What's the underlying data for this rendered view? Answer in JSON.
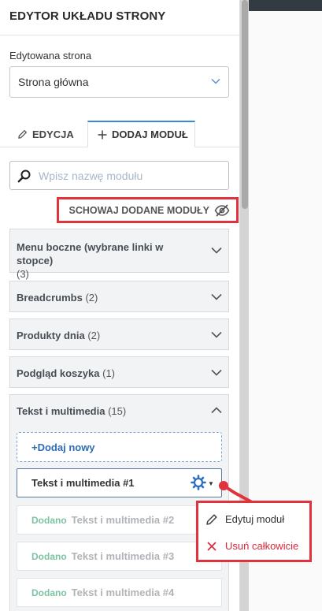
{
  "panel": {
    "title": "EDYTOR UKŁADU STRONY",
    "edited_page_label": "Edytowana strona",
    "edited_page_value": "Strona główna"
  },
  "tabs": {
    "edit_label": "EDYCJA",
    "add_label": "DODAJ MODUŁ"
  },
  "search": {
    "placeholder": "Wpisz nazwę modułu"
  },
  "hide_added_label": "SCHOWAJ DODANE MODUŁY",
  "groups": [
    {
      "name": "Menu boczne (wybrane linki w stopce)",
      "count": "(3)"
    },
    {
      "name": "Breadcrumbs",
      "count": "(2)"
    },
    {
      "name": "Produkty dnia",
      "count": "(2)"
    },
    {
      "name": "Podgląd koszyka",
      "count": "(1)"
    },
    {
      "name": "Tekst i multimedia",
      "count": "(15)"
    }
  ],
  "add_new_label": "+Dodaj nowy",
  "modules": [
    {
      "name": "Tekst i multimedia #1",
      "badge": ""
    },
    {
      "name": "Tekst i multimedia #2",
      "badge": "Dodano"
    },
    {
      "name": "Tekst i multimedia #3",
      "badge": "Dodano"
    },
    {
      "name": "Tekst i multimedia #4",
      "badge": "Dodano"
    }
  ],
  "context_menu": {
    "edit_label": "Edytuj moduł",
    "delete_label": "Usuń całkowicie"
  },
  "colors": {
    "accent": "#3b86d6",
    "highlight": "#e0333d",
    "added_badge": "#7cc3a2",
    "delete": "#d6283a"
  },
  "icons": {
    "pencil": "pencil-icon",
    "plus": "plus-icon",
    "search": "search-icon",
    "eye_off": "eye-off-icon",
    "chevron_down": "chevron-down-icon",
    "chevron_up": "chevron-up-icon",
    "gear": "gear-icon",
    "close": "close-icon"
  }
}
